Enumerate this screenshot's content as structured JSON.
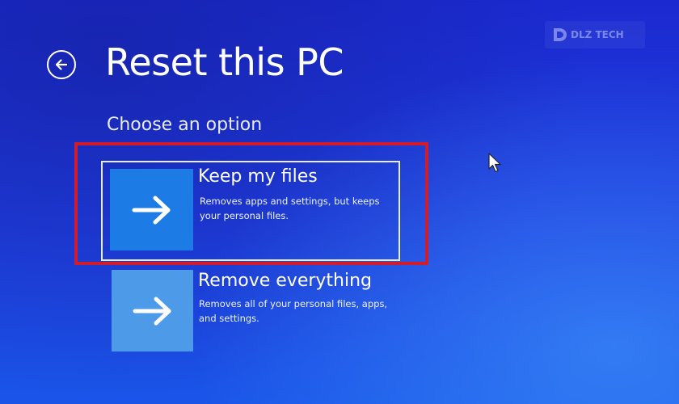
{
  "header": {
    "back_icon": "arrow-left-circle-icon",
    "title": "Reset this PC",
    "subtitle": "Choose an option"
  },
  "options": [
    {
      "name": "Keep my files",
      "description": "Removes apps and settings, but keeps your personal files.",
      "icon": "arrow-right-icon",
      "tile_color": "#1d7be6",
      "selected": true
    },
    {
      "name": "Remove everything",
      "description": "Removes all of your personal files, apps, and settings.",
      "icon": "arrow-right-icon",
      "tile_color": "#4c9ae8",
      "selected": false
    }
  ],
  "annotation": {
    "highlight_color": "#d21c2c",
    "target": "Keep my files"
  },
  "watermark": {
    "text": "DLZ TECH"
  },
  "colors": {
    "background": "#1f3ee0",
    "text": "#ffffff"
  }
}
